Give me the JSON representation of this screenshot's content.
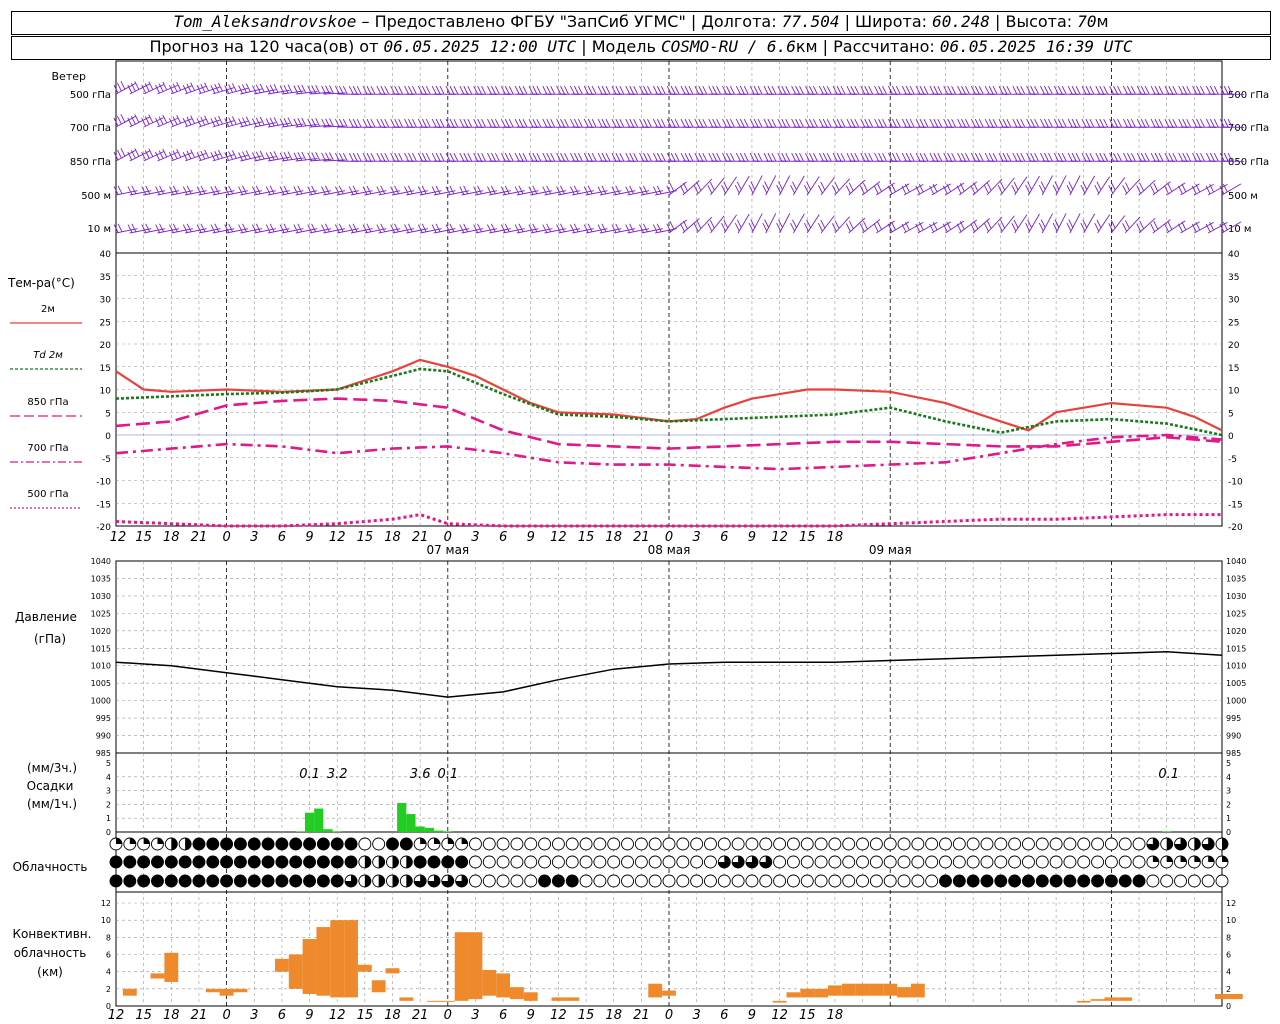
{
  "header": {
    "station": "Tom_Aleksandrovskoe",
    "provider": " – Предоставлено ФГБУ \"ЗапСиб УГМС\" | Долгота: ",
    "longitude": "77.504",
    "lat_label": " | Широта: ",
    "latitude": "60.248",
    "alt_label": " | Высота: ",
    "altitude": "70",
    "alt_unit": "м",
    "forecast_label": "Прогноз на 120 часа(ов) от ",
    "forecast_from": "06.05.2025 12:00 UTC",
    "model_label": "  | Модель ",
    "model": "COSMO-RU / 6.6",
    "model_unit": "км",
    "calc_label": " | Рассчитано: ",
    "calculated": "06.05.2025 16:39 UTC"
  },
  "colors": {
    "wind": "#7a1fd0",
    "t2m": "#e8423c",
    "td2m": "#1a7a1a",
    "t850": "#e01888",
    "t700": "#e01888",
    "t500": "#e01888",
    "pressure": "#000000",
    "precip": "#22cc22",
    "convective": "#ef8a2c",
    "grid": "#999999"
  },
  "panels": {
    "wind": {
      "title": "Ветер",
      "levels": [
        "500 гПа",
        "700 гПа",
        "850 гПа",
        "500  м",
        "10   м"
      ]
    },
    "temp": {
      "title": "Тем-ра(°C)",
      "legend": [
        "2м",
        "Td  2м",
        "850 гПа",
        "700 гПа",
        "500 гПа"
      ]
    },
    "pressure": {
      "title1": "Давление",
      "title2": "(гПа)"
    },
    "precip": {
      "title1": "(мм/3ч.)",
      "title2": "Осадки",
      "title3": "(мм/1ч.)",
      "sums": [
        {
          "x": 21,
          "text": "0.1"
        },
        {
          "x": 24,
          "text": "3.2"
        },
        {
          "x": 33,
          "text": "3.6"
        },
        {
          "x": 36,
          "text": "0.1"
        },
        {
          "x": 114,
          "text": "0.1"
        }
      ]
    },
    "clouds": {
      "title": "Облачность"
    },
    "conv": {
      "title1": "Конвективн.",
      "title2": "облачность",
      "title3": "(км)"
    }
  },
  "date_labels": [
    {
      "x": 36,
      "text": "07 мая"
    },
    {
      "x": 60,
      "text": "08 мая"
    },
    {
      "x": 84,
      "text": "09 мая"
    }
  ],
  "hour_ticks": [
    "12",
    "15",
    "18",
    "21",
    "0",
    "3",
    "6",
    "9",
    "12",
    "15",
    "18",
    "21",
    "0",
    "3",
    "6",
    "9",
    "12",
    "15",
    "18",
    "21",
    "0",
    "3",
    "6",
    "9",
    "12",
    "15",
    "18"
  ],
  "chart_data": [
    {
      "type": "line",
      "title": "Тем-ра(°C)",
      "x_unit": "hours from 06.05.2025 12:00 UTC",
      "ylim": [
        -20,
        40
      ],
      "yticks": [
        -20,
        -15,
        -10,
        -5,
        0,
        5,
        10,
        15,
        20,
        25,
        30,
        35,
        40
      ],
      "series": [
        {
          "name": "2м",
          "x": [
            0,
            3,
            6,
            12,
            18,
            24,
            30,
            33,
            36,
            39,
            42,
            45,
            48,
            54,
            60,
            63,
            66,
            69,
            72,
            75,
            78,
            84,
            90,
            96,
            99,
            102,
            108,
            114,
            117,
            120
          ],
          "y": [
            14,
            10,
            9.5,
            10,
            9.5,
            10,
            14,
            16.5,
            15,
            13,
            10,
            7,
            5,
            4.5,
            3,
            3.5,
            6,
            8,
            9,
            10,
            10,
            9.5,
            7,
            3,
            1,
            5,
            7,
            6,
            4,
            1
          ]
        },
        {
          "name": "Td  2м",
          "x": [
            0,
            6,
            12,
            18,
            24,
            30,
            33,
            36,
            42,
            48,
            54,
            60,
            66,
            72,
            78,
            84,
            90,
            96,
            102,
            108,
            114,
            120
          ],
          "y": [
            8,
            8.5,
            9,
            9.3,
            10,
            13,
            14.5,
            14,
            9,
            4.5,
            4,
            3,
            3.5,
            4,
            4.5,
            6,
            3,
            0.5,
            3,
            3.5,
            2.5,
            0
          ]
        },
        {
          "name": "850 гПа",
          "x": [
            0,
            6,
            12,
            18,
            24,
            30,
            36,
            42,
            48,
            54,
            60,
            66,
            72,
            78,
            84,
            90,
            96,
            102,
            108,
            114,
            120
          ],
          "y": [
            2,
            3,
            6.5,
            7.5,
            8,
            7.5,
            6,
            1,
            -2,
            -2.5,
            -3,
            -2.5,
            -2,
            -1.5,
            -1.5,
            -2,
            -2.5,
            -2.5,
            -1.5,
            -0.5,
            -1.5
          ]
        },
        {
          "name": "700 гПа",
          "x": [
            0,
            6,
            12,
            18,
            24,
            30,
            36,
            42,
            48,
            54,
            60,
            66,
            72,
            78,
            84,
            90,
            96,
            102,
            108,
            114,
            120
          ],
          "y": [
            -4,
            -3,
            -2,
            -2.5,
            -4,
            -3,
            -2.5,
            -4,
            -6,
            -6.5,
            -6.5,
            -7,
            -7.5,
            -7,
            -6.5,
            -6,
            -4,
            -2,
            -0.5,
            0,
            -1
          ]
        },
        {
          "name": "500 гПа",
          "x": [
            0,
            6,
            12,
            18,
            24,
            30,
            33,
            36,
            42,
            48,
            54,
            60,
            66,
            72,
            78,
            84,
            90,
            96,
            102,
            108,
            114,
            120
          ],
          "y": [
            -19,
            -19.5,
            -20,
            -20,
            -19.5,
            -18.5,
            -17.5,
            -19.5,
            -21,
            -21.5,
            -21.5,
            -21.5,
            -21.5,
            -21,
            -20.5,
            -19.5,
            -19,
            -18.5,
            -18.5,
            -18,
            -17.5,
            -17.5
          ]
        }
      ]
    },
    {
      "type": "line",
      "title": "Давление",
      "ylabel": "(гПа)",
      "x_unit": "hours from 06.05.2025 12:00 UTC",
      "ylim": [
        985,
        1040
      ],
      "yticks": [
        985,
        990,
        995,
        1000,
        1005,
        1010,
        1015,
        1020,
        1025,
        1030,
        1035,
        1040
      ],
      "series": [
        {
          "name": "Давление",
          "x": [
            0,
            6,
            12,
            18,
            24,
            30,
            36,
            42,
            48,
            54,
            60,
            66,
            72,
            78,
            84,
            90,
            96,
            102,
            108,
            114,
            120
          ],
          "y": [
            1011,
            1010,
            1008,
            1006,
            1004,
            1003,
            1001,
            1002.5,
            1006,
            1009,
            1010.5,
            1011,
            1011,
            1011,
            1011.5,
            1012,
            1012.5,
            1013,
            1013.5,
            1014,
            1013
          ]
        }
      ]
    },
    {
      "type": "bar",
      "title": "Осадки",
      "ylabel": "(мм/1ч.)",
      "x_unit": "hours from 06.05.2025 12:00 UTC",
      "ylim": [
        0,
        5
      ],
      "series": [
        {
          "x": [
            20,
            21,
            22,
            23,
            24,
            31,
            32,
            33,
            34,
            35,
            36,
            114
          ],
          "values": [
            0.05,
            1.4,
            1.7,
            0.2,
            0.05,
            2.1,
            1.3,
            0.4,
            0.3,
            0.1,
            0.05,
            0.05
          ]
        }
      ]
    },
    {
      "type": "bar",
      "title": "Конвективн. облачность",
      "ylabel": "(км)",
      "x_unit": "hours from 06.05.2025 12:00 UTC",
      "ylim": [
        0,
        13
      ],
      "bars": [
        {
          "x": 1,
          "bottom": 1.2,
          "top": 2
        },
        {
          "x": 3,
          "bottom": 3.2,
          "top": 3.8
        },
        {
          "x": 4,
          "bottom": 2.8,
          "top": 6.2
        },
        {
          "x": 7,
          "bottom": 1.6,
          "top": 2
        },
        {
          "x": 8,
          "bottom": 1.2,
          "top": 2
        },
        {
          "x": 9,
          "bottom": 1.6,
          "top": 2
        },
        {
          "x": 12,
          "bottom": 4,
          "top": 5.5
        },
        {
          "x": 13,
          "bottom": 2,
          "top": 6
        },
        {
          "x": 14,
          "bottom": 1.4,
          "top": 7.8
        },
        {
          "x": 15,
          "bottom": 1.2,
          "top": 9.2
        },
        {
          "x": 16,
          "bottom": 1,
          "top": 10
        },
        {
          "x": 17,
          "bottom": 1,
          "top": 10
        },
        {
          "x": 18,
          "bottom": 4,
          "top": 4.8
        },
        {
          "x": 19,
          "bottom": 1.6,
          "top": 3
        },
        {
          "x": 20,
          "bottom": 3.8,
          "top": 4.4
        },
        {
          "x": 21,
          "bottom": 0.6,
          "top": 1
        },
        {
          "x": 23,
          "bottom": 0.5,
          "top": 0.6
        },
        {
          "x": 24,
          "bottom": 0.5,
          "top": 0.6
        },
        {
          "x": 25,
          "bottom": 0.6,
          "top": 8.6
        },
        {
          "x": 26,
          "bottom": 0.8,
          "top": 8.6
        },
        {
          "x": 27,
          "bottom": 1.2,
          "top": 4.2
        },
        {
          "x": 28,
          "bottom": 1,
          "top": 3.8
        },
        {
          "x": 29,
          "bottom": 0.8,
          "top": 2.2
        },
        {
          "x": 30,
          "bottom": 0.6,
          "top": 1.6
        },
        {
          "x": 32,
          "bottom": 0.6,
          "top": 1
        },
        {
          "x": 33,
          "bottom": 0.6,
          "top": 1
        },
        {
          "x": 39,
          "bottom": 1,
          "top": 2.6
        },
        {
          "x": 40,
          "bottom": 1.2,
          "top": 1.8
        },
        {
          "x": 48,
          "bottom": 0.4,
          "top": 0.6
        },
        {
          "x": 49,
          "bottom": 1,
          "top": 1.6
        },
        {
          "x": 50,
          "bottom": 1,
          "top": 2
        },
        {
          "x": 51,
          "bottom": 1,
          "top": 2
        },
        {
          "x": 52,
          "bottom": 1.2,
          "top": 2.4
        },
        {
          "x": 53,
          "bottom": 1.2,
          "top": 2.6
        },
        {
          "x": 54,
          "bottom": 1.2,
          "top": 2.6
        },
        {
          "x": 55,
          "bottom": 1.2,
          "top": 2.6
        },
        {
          "x": 56,
          "bottom": 1.2,
          "top": 2.6
        },
        {
          "x": 57,
          "bottom": 1,
          "top": 2.2
        },
        {
          "x": 58,
          "bottom": 1,
          "top": 2.6
        },
        {
          "x": 70,
          "bottom": 0.4,
          "top": 0.6
        },
        {
          "x": 71,
          "bottom": 0.6,
          "top": 0.8
        },
        {
          "x": 72,
          "bottom": 0.6,
          "top": 1
        },
        {
          "x": 73,
          "bottom": 0.6,
          "top": 1
        },
        {
          "x": 80,
          "bottom": 0.8,
          "top": 1.4
        },
        {
          "x": 81,
          "bottom": 0.8,
          "top": 1.4
        }
      ]
    }
  ]
}
